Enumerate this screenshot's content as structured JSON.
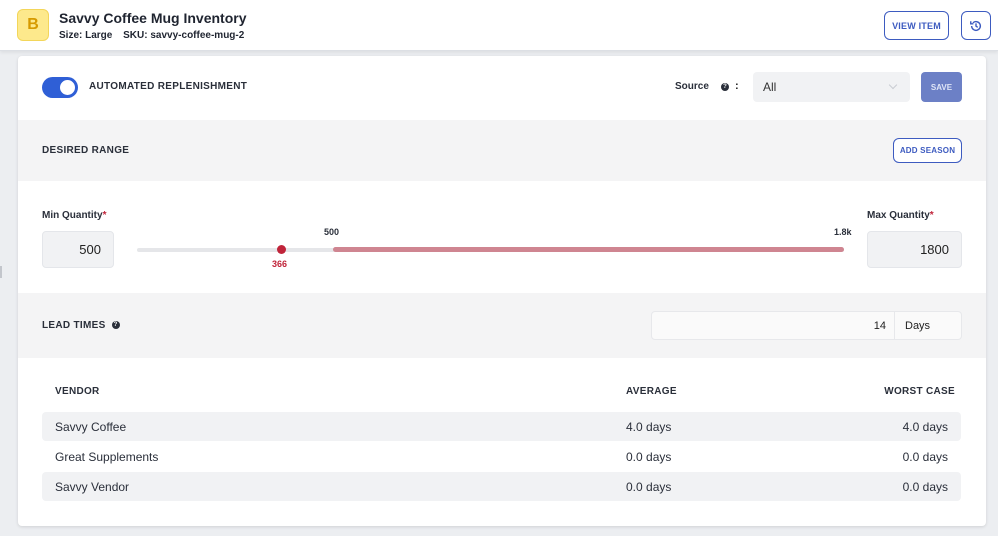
{
  "header": {
    "logo_letter": "B",
    "title": "Savvy Coffee Mug Inventory",
    "size_label": "Size:",
    "size_value": "Large",
    "sku_label": "SKU:",
    "sku_value": "savvy-coffee-mug-2",
    "view_item_label": "VIEW ITEM",
    "history_icon": "history-icon"
  },
  "replenishment": {
    "toggle_on": true,
    "label": "AUTOMATED REPLENISHMENT",
    "source_label": "Source",
    "source_colon": ":",
    "source_value": "All",
    "save_label": "SAVE"
  },
  "desired_range": {
    "title": "DESIRED RANGE",
    "add_season_label": "ADD SEASON",
    "min_label": "Min Quantity",
    "min_value": "500",
    "max_label": "Max Quantity",
    "max_value": "1800",
    "required_mark": "*",
    "slider": {
      "range_start_label": "500",
      "range_end_label": "1.8k",
      "current_label": "366",
      "current_value": 366,
      "min": 500,
      "max": 1800
    }
  },
  "lead_times": {
    "title": "LEAD TIMES",
    "value": "14",
    "unit": "Days"
  },
  "vendors": {
    "headers": [
      "VENDOR",
      "AVERAGE",
      "WORST CASE"
    ],
    "rows": [
      [
        "Savvy Coffee",
        "4.0 days",
        "4.0 days"
      ],
      [
        "Great Supplements",
        "0.0 days",
        "0.0 days"
      ],
      [
        "Savvy Vendor",
        "0.0 days",
        "0.0 days"
      ]
    ]
  },
  "colors": {
    "accent": "#2f5fd6",
    "save_button": "#6c80c6",
    "slider_fill": "#cf8591",
    "slider_marker": "#c0243a",
    "logo_bg": "#fde98c"
  }
}
